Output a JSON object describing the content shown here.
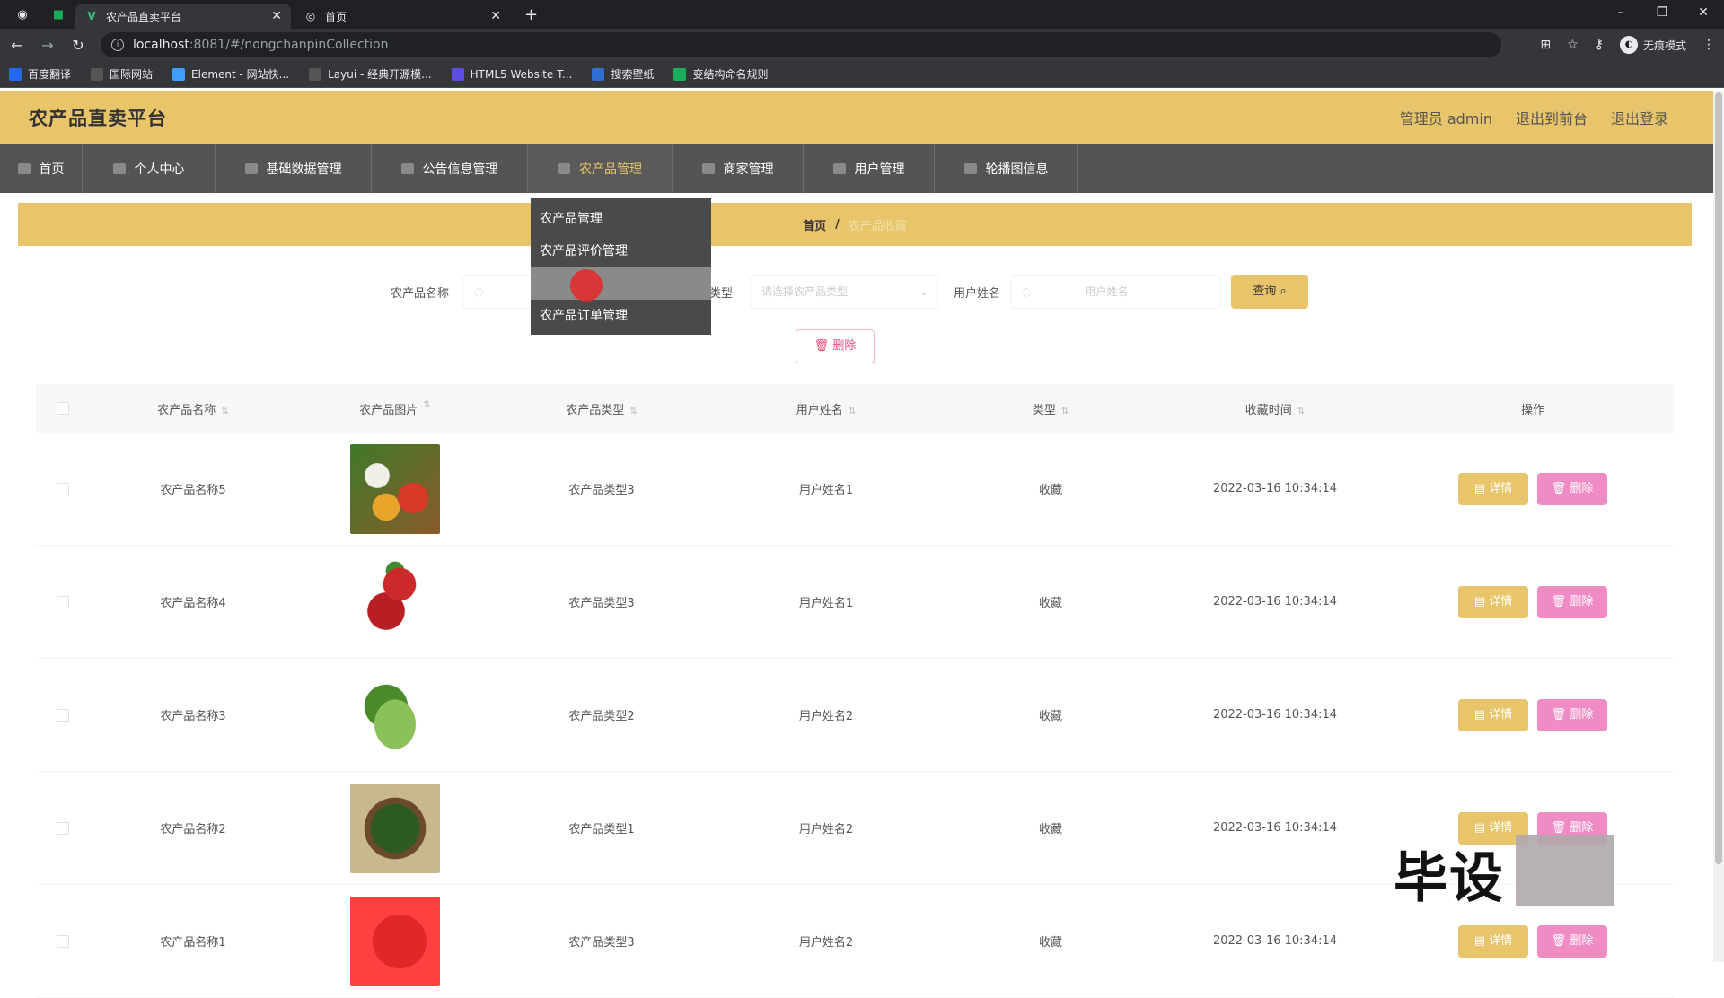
{
  "browser": {
    "tabs": [
      {
        "title": "农产品直卖平台",
        "active": true
      },
      {
        "title": "首页",
        "active": false
      }
    ],
    "url_host": "localhost",
    "url_path": ":8081/#/nongchanpinCollection",
    "incognito_label": "无痕模式",
    "bookmarks": [
      {
        "label": "百度翻译",
        "color": "#2468f2"
      },
      {
        "label": "国际网站",
        "color": "#555555"
      },
      {
        "label": "Element - 网站快...",
        "color": "#409eff"
      },
      {
        "label": "Layui - 经典开源模...",
        "color": "#555555"
      },
      {
        "label": "HTML5 Website T...",
        "color": "#5c4ee5"
      },
      {
        "label": "搜索壁纸",
        "color": "#2f6fd6"
      },
      {
        "label": "变结构命名规则",
        "color": "#1aad5a"
      }
    ]
  },
  "app": {
    "title": "农产品直卖平台",
    "header_links": [
      "管理员 admin",
      "退出到前台",
      "退出登录"
    ],
    "menu": [
      {
        "label": "首页",
        "width": 92
      },
      {
        "label": "个人中心",
        "width": 148
      },
      {
        "label": "基础数据管理",
        "width": 174
      },
      {
        "label": "公告信息管理",
        "width": 174
      },
      {
        "label": "农产品管理",
        "width": 161,
        "active": true
      },
      {
        "label": "商家管理",
        "width": 146
      },
      {
        "label": "用户管理",
        "width": 146
      },
      {
        "label": "轮播图信息",
        "width": 160
      }
    ],
    "dropdown": [
      "农产品管理",
      "农产品评价管理",
      "",
      "农产品订单管理"
    ],
    "breadcrumb": {
      "home": "首页",
      "separator": "/",
      "current": "农产品收藏"
    },
    "search": {
      "label_name": "农产品名称",
      "label_type": "类型",
      "type_placeholder": "请选择农产品类型",
      "label_user": "用户姓名",
      "user_placeholder": "用户姓名",
      "query_label": "查询",
      "delete_label": "删除"
    },
    "table": {
      "headers": [
        "农产品名称",
        "农产品图片",
        "农产品类型",
        "用户姓名",
        "类型",
        "收藏时间",
        "操作"
      ],
      "rows": [
        {
          "name": "农产品名称5",
          "type": "农产品类型3",
          "user": "用户姓名1",
          "kind": "收藏",
          "time": "2022-03-16 10:34:14"
        },
        {
          "name": "农产品名称4",
          "type": "农产品类型3",
          "user": "用户姓名1",
          "kind": "收藏",
          "time": "2022-03-16 10:34:14"
        },
        {
          "name": "农产品名称3",
          "type": "农产品类型2",
          "user": "用户姓名2",
          "kind": "收藏",
          "time": "2022-03-16 10:34:14"
        },
        {
          "name": "农产品名称2",
          "type": "农产品类型1",
          "user": "用户姓名2",
          "kind": "收藏",
          "time": "2022-03-16 10:34:14"
        },
        {
          "name": "农产品名称1",
          "type": "农产品类型3",
          "user": "用户姓名2",
          "kind": "收藏",
          "time": "2022-03-16 10:34:14"
        }
      ],
      "detail_label": "详情",
      "delete_label": "删除"
    },
    "watermark": "毕设"
  }
}
